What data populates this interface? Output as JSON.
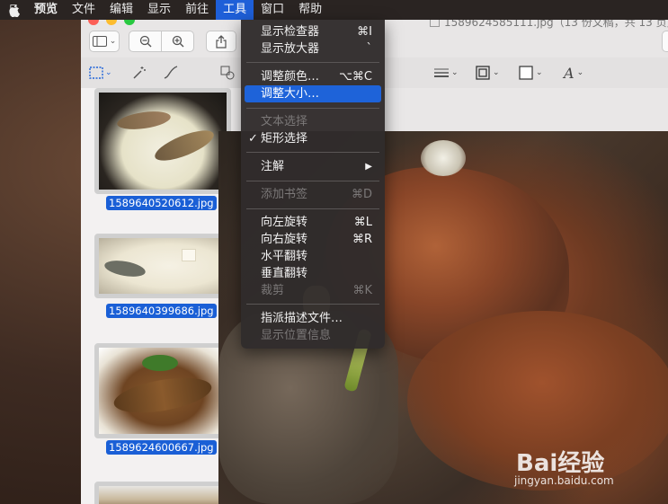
{
  "menubar": {
    "items": [
      "预览",
      "文件",
      "编辑",
      "显示",
      "前往",
      "工具",
      "窗口",
      "帮助"
    ],
    "active_index": 5
  },
  "window": {
    "title": "1589624585111.jpg（13 份文稿，共 13 页）"
  },
  "sidebar": {
    "thumbnails": [
      {
        "label": "1589640520612.jpg"
      },
      {
        "label": "1589640399686.jpg"
      },
      {
        "label": "1589624600667.jpg"
      }
    ]
  },
  "tools_menu": {
    "items": [
      {
        "label": "显示检查器",
        "shortcut": "⌘I",
        "state": "normal"
      },
      {
        "label": "显示放大器",
        "shortcut": "`",
        "state": "normal"
      },
      {
        "label": "调整颜色…",
        "shortcut": "⌥⌘C",
        "state": "normal"
      },
      {
        "label": "调整大小…",
        "shortcut": "",
        "state": "highlighted"
      },
      {
        "label": "文本选择",
        "shortcut": "",
        "state": "disabled"
      },
      {
        "label": "矩形选择",
        "shortcut": "",
        "state": "checked"
      },
      {
        "label": "注解",
        "shortcut": "▶",
        "state": "normal"
      },
      {
        "label": "添加书签",
        "shortcut": "⌘D",
        "state": "disabled"
      },
      {
        "label": "向左旋转",
        "shortcut": "⌘L",
        "state": "normal"
      },
      {
        "label": "向右旋转",
        "shortcut": "⌘R",
        "state": "normal"
      },
      {
        "label": "水平翻转",
        "shortcut": "",
        "state": "normal"
      },
      {
        "label": "垂直翻转",
        "shortcut": "",
        "state": "normal"
      },
      {
        "label": "裁剪",
        "shortcut": "⌘K",
        "state": "disabled"
      },
      {
        "label": "指派描述文件…",
        "shortcut": "",
        "state": "normal"
      },
      {
        "label": "显示位置信息",
        "shortcut": "",
        "state": "disabled"
      }
    ]
  },
  "watermark": {
    "text": "Bai经验",
    "url": "jingyan.baidu.com"
  },
  "colors": {
    "accent": "#1e63d9",
    "menubar_bg": "#2a2422",
    "menu_bg": "#302c2c"
  }
}
